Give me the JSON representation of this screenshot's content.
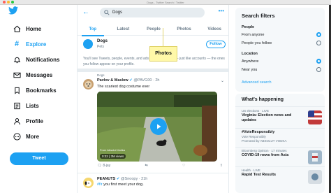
{
  "window": {
    "title": "Dogs - Twitter Search / Twitter"
  },
  "sidebar": {
    "items": [
      {
        "label": "Home",
        "icon": "home-icon"
      },
      {
        "label": "Explore",
        "icon": "hashtag-icon",
        "active": true
      },
      {
        "label": "Notifications",
        "icon": "bell-icon"
      },
      {
        "label": "Messages",
        "icon": "envelope-icon"
      },
      {
        "label": "Bookmarks",
        "icon": "bookmark-icon"
      },
      {
        "label": "Lists",
        "icon": "list-icon"
      },
      {
        "label": "Profile",
        "icon": "person-icon"
      },
      {
        "label": "More",
        "icon": "more-circle-icon"
      }
    ],
    "tweet_button": "Tweet"
  },
  "search": {
    "query": "Dogs"
  },
  "tabs": [
    "Top",
    "Latest",
    "People",
    "Photos",
    "Videos"
  ],
  "active_tab": "Top",
  "callout": "Photos",
  "topic": {
    "name": "Dogs",
    "subtitle": "Pets",
    "follow": "Follow"
  },
  "notice": "You'll see Tweets, people, events, and ads about this Topic — just like accounts — the ones you follow appear on your profile.",
  "tweet1": {
    "topic": "Dogs",
    "name": "Pavlov & Maslow",
    "handle": "@PAVG00 · 2h",
    "text": "The scariest dog costume ever",
    "video_time": "0:32",
    "video_views": "3M views",
    "source": "From Absolut Vodka",
    "actions": [
      "8-jay",
      "",
      "",
      ""
    ]
  },
  "tweet2": {
    "name": "PEANUTS",
    "handle": "@Snoopy · 21h",
    "hashtag": "#fir",
    "text": " you first meet your dog."
  },
  "filters": {
    "title": "Search filters",
    "people_label": "People",
    "people_options": [
      "From anyone",
      "People you follow"
    ],
    "location_label": "Location",
    "location_options": [
      "Anywhere",
      "Near you"
    ],
    "advanced": "Advanced search"
  },
  "happening": {
    "title": "What's happening",
    "trends": [
      {
        "meta": "US elections · LIVE",
        "name": "Virginia: Election news and updates"
      },
      {
        "meta": "Promoted",
        "name": "#VoteResponsibly"
      },
      {
        "meta": "Bloomberg Opinion · 17 minutes",
        "name": "COVID-19 news from Asia"
      },
      {
        "meta": "Health · LIVE",
        "name": "Rapid Test Results"
      }
    ],
    "trend2_sub": "Vote Responsibly",
    "trend2_promoted": "Promoted by ABSOLUT VODKA"
  },
  "colors": {
    "accent": "#1da1f2",
    "text": "#14171a",
    "muted": "#657786",
    "callout": "#fff8a8"
  }
}
